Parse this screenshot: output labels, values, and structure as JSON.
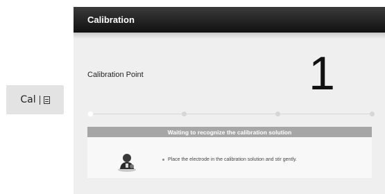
{
  "cal_button": {
    "label": "Cal",
    "icon": "document-icon"
  },
  "window": {
    "title": "Calibration"
  },
  "calibration_point": {
    "label": "Calibration Point",
    "value": "1"
  },
  "progress": {
    "total_points": 4,
    "current_index": 1
  },
  "status": {
    "header": "Waiting to recognize the calibration solution",
    "instruction": "Place the electrode in the calibration solution and stir gently.",
    "icon": "person-electrode-icon"
  },
  "colors": {
    "titlebar": "#1d1d1d",
    "panel_bg": "#efefef",
    "status_header_bg": "#a6a6a6",
    "track": "#d6d6d6"
  }
}
